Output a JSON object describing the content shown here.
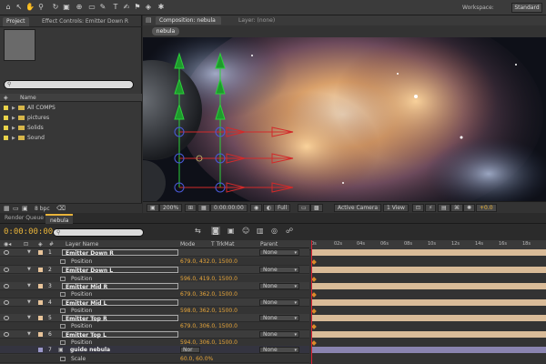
{
  "toolbar": {
    "workspace_label": "Workspace:",
    "workspace_value": "Standard"
  },
  "project_panel": {
    "tab_project": "Project",
    "tab_effects": "Effect Controls: Emitter Down R",
    "column_name": "Name",
    "items": [
      {
        "label": "All COMPS"
      },
      {
        "label": "pictures"
      },
      {
        "label": "Solids"
      },
      {
        "label": "Sound"
      }
    ],
    "bpc": "8 bpc"
  },
  "viewer": {
    "comp_tab": "Composition: nebula",
    "layer_tab": "Layer: (none)",
    "crumb": "nebula",
    "zoom": "200%",
    "resolution": "Full",
    "camera": "Active Camera",
    "view": "1 View",
    "exposure": "+0.0"
  },
  "timeline": {
    "tab_render": "Render Queue",
    "tab_comp": "nebula",
    "timecode": "0:00:00:00",
    "col_layer_name": "Layer Name",
    "col_mode": "Mode",
    "col_trkmat": "T  TrkMat",
    "col_parent": "Parent",
    "layers": [
      {
        "num": "1",
        "name": "Emitter Down R",
        "prop": "Position",
        "value": "679.0, 432.0, 1500.0",
        "parent": "None"
      },
      {
        "num": "2",
        "name": "Emitter Down L",
        "prop": "Position",
        "value": "596.0, 419.0, 1500.0",
        "parent": "None"
      },
      {
        "num": "3",
        "name": "Emitter Mid R",
        "prop": "Position",
        "value": "679.0, 362.0, 1500.0",
        "parent": "None"
      },
      {
        "num": "4",
        "name": "Emitter Mid L",
        "prop": "Position",
        "value": "598.0, 362.0, 1500.0",
        "parent": "None"
      },
      {
        "num": "5",
        "name": "Emitter Top R",
        "prop": "Position",
        "value": "679.0, 306.0, 1500.0",
        "parent": "None"
      },
      {
        "num": "6",
        "name": "Emitter Top L",
        "prop": "Position",
        "value": "594.0, 306.0, 1500.0",
        "parent": "None"
      },
      {
        "num": "7",
        "name": "guide nebula",
        "prop": "Scale",
        "value": "60.0, 60.0%",
        "parent": "None",
        "mode": "Nor"
      }
    ],
    "ruler_ticks": [
      "0s",
      "02s",
      "04s",
      "06s",
      "08s",
      "10s",
      "12s",
      "14s",
      "16s",
      "18s"
    ]
  },
  "colors": {
    "accent": "#e8b33a",
    "layer_label": "#d9bb98",
    "guide_bar": "#8a84b0"
  }
}
